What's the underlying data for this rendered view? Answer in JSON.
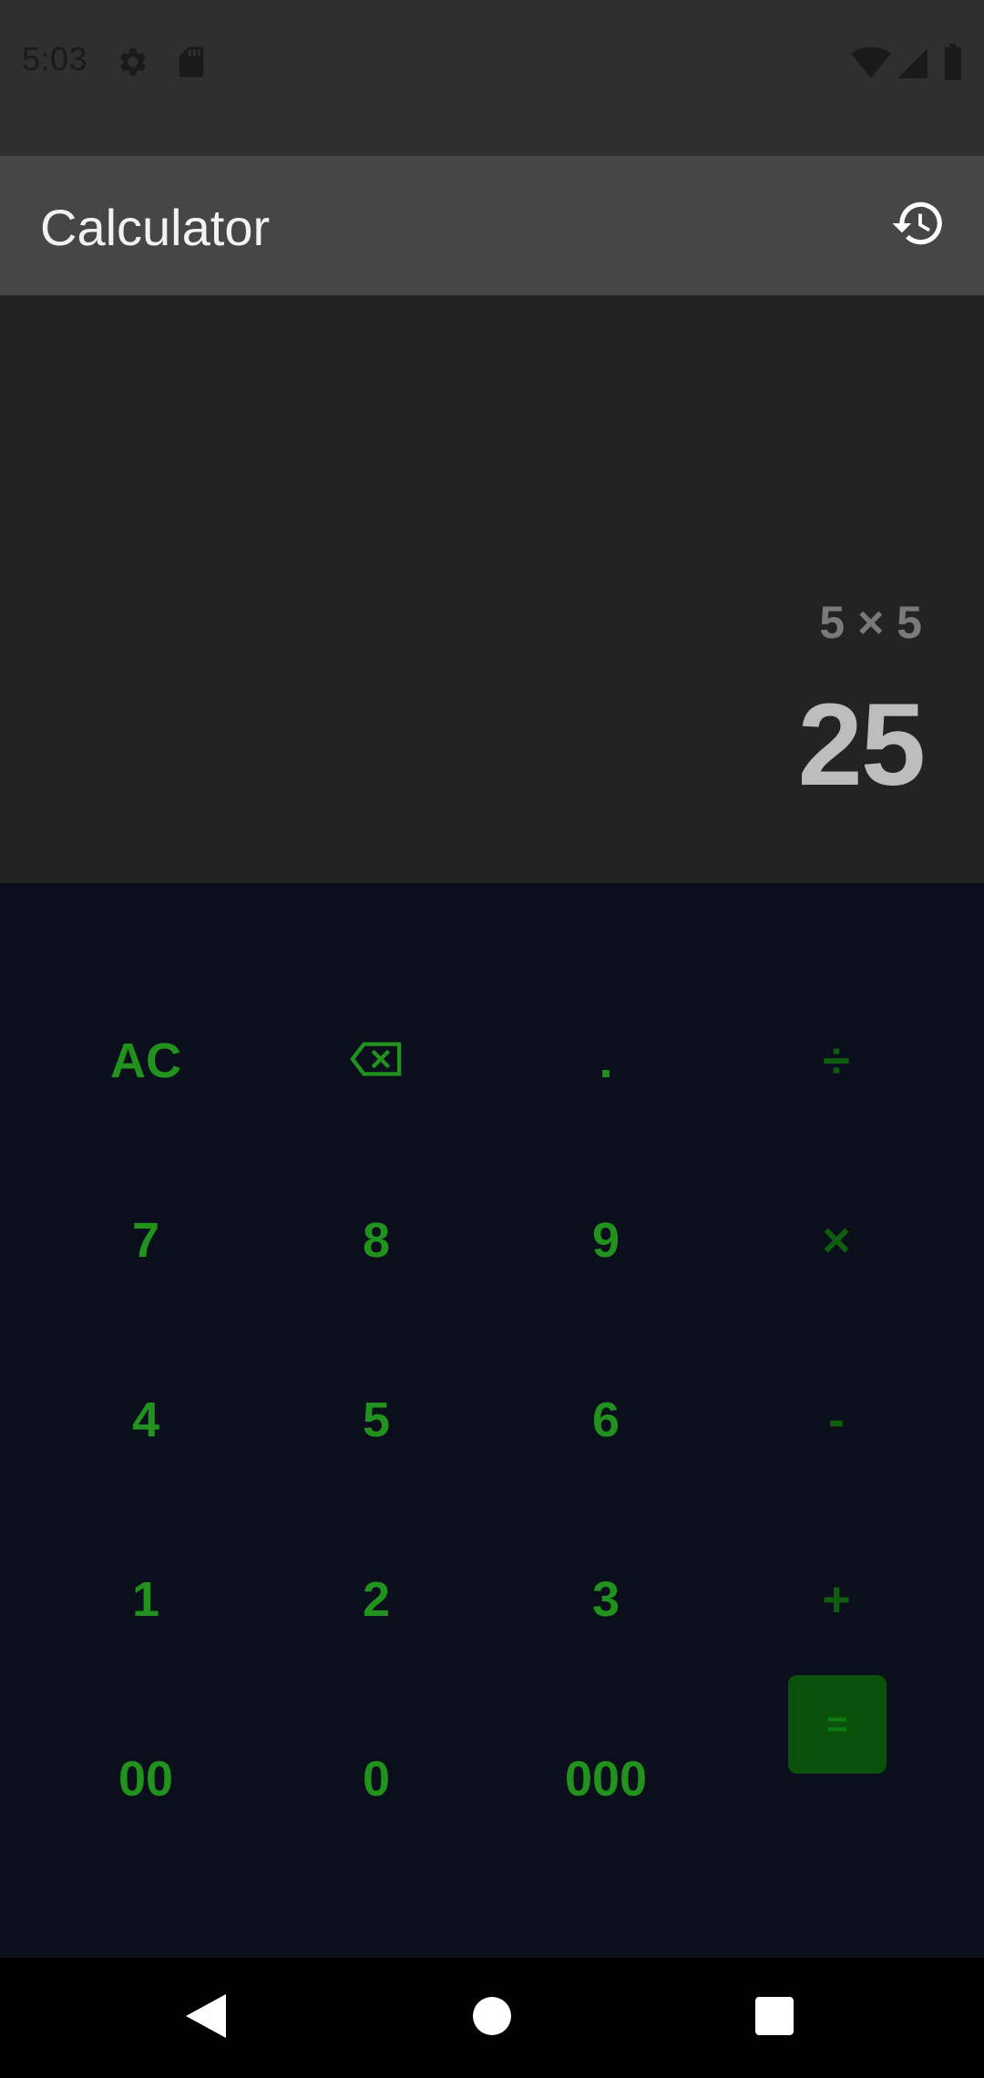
{
  "status_bar": {
    "time": "5:03",
    "icons": [
      "gear-icon",
      "sd-card-icon",
      "wifi-icon",
      "cell-signal-icon",
      "battery-icon"
    ]
  },
  "app_bar": {
    "title": "Calculator",
    "history_icon": "history-icon"
  },
  "display": {
    "expression": "5 × 5",
    "result": "25"
  },
  "keypad": {
    "rows": [
      [
        {
          "label": "AC"
        },
        {
          "label": "⌫",
          "icon": "backspace-icon"
        },
        {
          "label": "."
        },
        {
          "label": "÷"
        }
      ],
      [
        {
          "label": "7"
        },
        {
          "label": "8"
        },
        {
          "label": "9"
        },
        {
          "label": "×"
        }
      ],
      [
        {
          "label": "4"
        },
        {
          "label": "5"
        },
        {
          "label": "6"
        },
        {
          "label": "-"
        }
      ],
      [
        {
          "label": "1"
        },
        {
          "label": "2"
        },
        {
          "label": "3"
        },
        {
          "label": "+"
        }
      ],
      [
        {
          "label": "00"
        },
        {
          "label": "0"
        },
        {
          "label": "000"
        },
        {
          "label": "="
        }
      ]
    ]
  },
  "nav_bar": {
    "icons": [
      "back-icon",
      "home-icon",
      "recents-icon"
    ]
  },
  "colors": {
    "key_text": "#22921f",
    "operator_text": "#0f5e10",
    "equals_bg": "#0a520c",
    "keypad_bg": "#0b0f1c",
    "display_bg": "#232323",
    "app_bar_bg": "#464646"
  }
}
